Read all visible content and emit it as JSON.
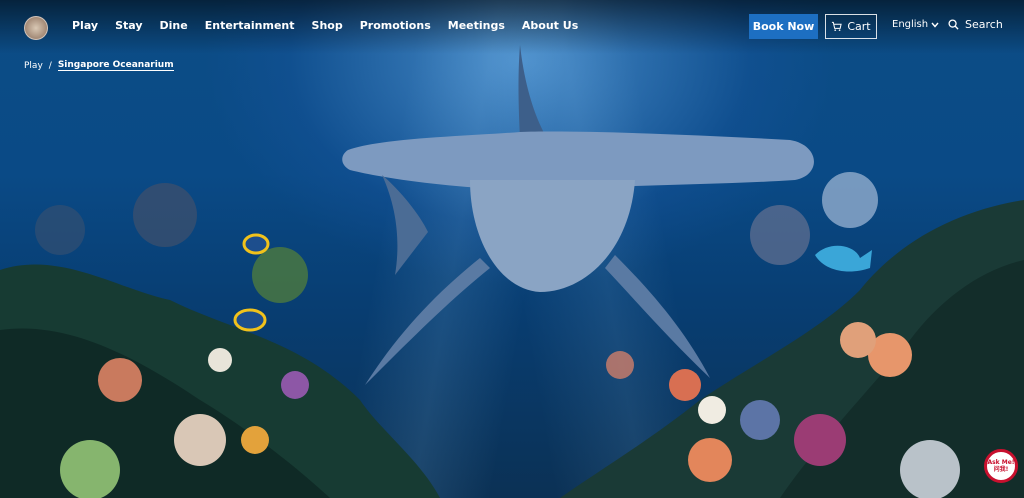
{
  "nav": {
    "items": [
      {
        "label": "Play"
      },
      {
        "label": "Stay"
      },
      {
        "label": "Dine"
      },
      {
        "label": "Entertainment"
      },
      {
        "label": "Shop"
      },
      {
        "label": "Promotions"
      },
      {
        "label": "Meetings"
      },
      {
        "label": "About Us"
      }
    ],
    "book_label": "Book Now",
    "cart_label": "Cart",
    "language_label": "English",
    "search_label": "Search"
  },
  "breadcrumb": {
    "parent": "Play",
    "separator": "/",
    "current": "Singapore Oceanarium"
  },
  "chat": {
    "label": "Ask Me!",
    "sub": "问我!"
  },
  "colors": {
    "accent": "#1d6fc2",
    "chat_ring": "#c8102e"
  }
}
